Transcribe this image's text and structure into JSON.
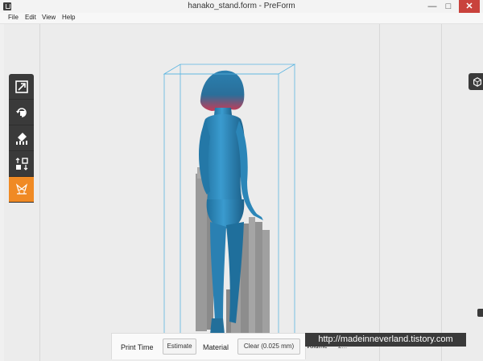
{
  "window": {
    "title": "hanako_stand.form - PreForm",
    "minimize_glyph": "—",
    "maximize_glyph": "□",
    "close_glyph": "✕"
  },
  "menu": [
    "File",
    "Edit",
    "View",
    "Help"
  ],
  "toolbar": {
    "tools": [
      {
        "name": "scale-tool",
        "icon": "resize-arrow-icon"
      },
      {
        "name": "rotate-tool",
        "icon": "rotate-icon"
      },
      {
        "name": "orientation-tool",
        "icon": "layout-icon"
      },
      {
        "name": "layout-tool",
        "icon": "arrange-icon"
      },
      {
        "name": "supports-tool",
        "icon": "supports-icon",
        "active": true
      }
    ],
    "accent": "#f08a24",
    "bg": "#3a3a3a"
  },
  "view_control": {
    "icon": "view-cube-icon"
  },
  "bottom_bar": {
    "print_time_label": "Print Time",
    "estimate_button": "Estimate",
    "material_label": "Material",
    "material_value": "Clear (0.025 mm)",
    "volume_label": "Volume",
    "volume_value": "2..."
  },
  "watermark": "http://madeinneverland.tistory.com",
  "colors": {
    "model": "#2e87b8",
    "hair_tint": "#c83a55",
    "supports": "#9a9a9a",
    "build_box": "#5ab4e0"
  }
}
